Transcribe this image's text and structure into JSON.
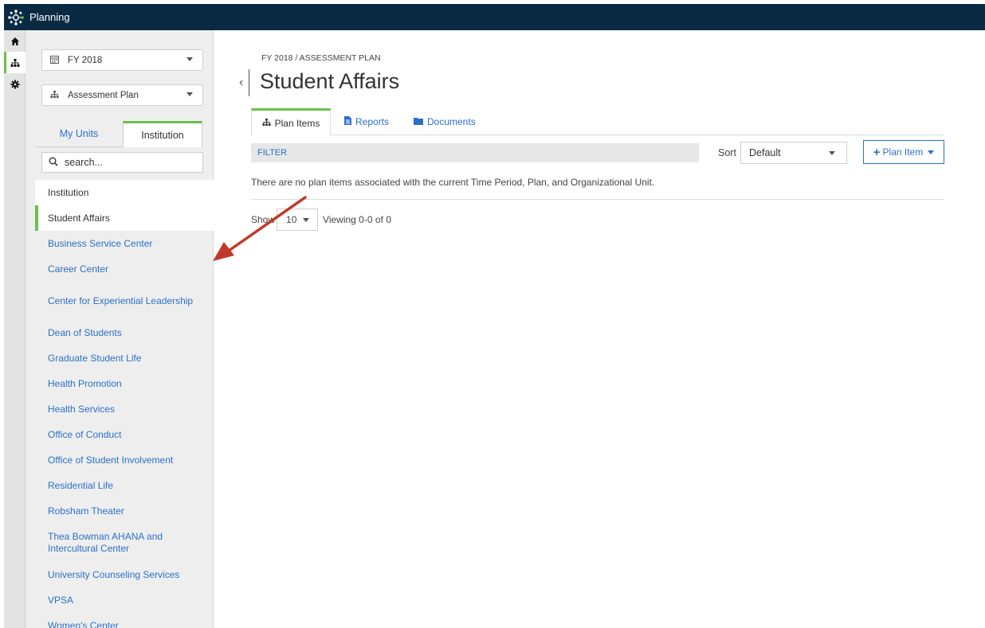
{
  "app": {
    "title": "Planning"
  },
  "rail": {
    "items": [
      {
        "icon": "home-icon"
      },
      {
        "icon": "org-chart-icon",
        "active": true
      },
      {
        "icon": "gear-icon"
      }
    ]
  },
  "sidebar": {
    "period_select": "FY 2018",
    "plan_select": "Assessment Plan",
    "tabs": [
      {
        "label": "My Units"
      },
      {
        "label": "Institution",
        "active": true
      }
    ],
    "search_placeholder": "search...",
    "orgs": [
      "Institution",
      "Student Affairs",
      "Business Service Center",
      "Career Center",
      "Center for Experiential Leadership",
      "Dean of Students",
      "Graduate Student Life",
      "Health Promotion",
      "Health Services",
      "Office of Conduct",
      "Office of Student Involvement",
      "Residential Life",
      "Robsham Theater",
      "Thea Bowman AHANA and Intercultural Center",
      "University Counseling Services",
      "VPSA",
      "Women's Center"
    ]
  },
  "main": {
    "breadcrumb": "FY 2018 / ASSESSMENT PLAN",
    "title": "Student Affairs",
    "tabs": [
      {
        "label": "Plan Items",
        "active": true
      },
      {
        "label": "Reports"
      },
      {
        "label": "Documents"
      }
    ],
    "filter_label": "FILTER",
    "sort_label": "Sort",
    "sort_value": "Default",
    "add_button_label": "Plan Item",
    "empty_message": "There are no plan items associated with the current Time Period, Plan, and Organizational Unit.",
    "show_label": "Show",
    "page_size": "10",
    "viewing": "Viewing 0-0 of 0"
  },
  "colors": {
    "topbar": "#0a2a44",
    "accent_green": "#6cc04a",
    "link_blue": "#2a71c8",
    "annotation_arrow": "#c0392b"
  }
}
